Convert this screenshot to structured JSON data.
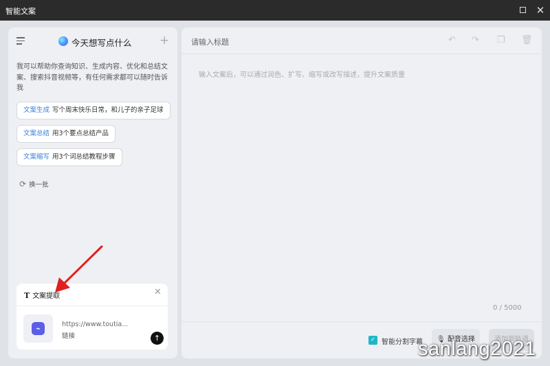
{
  "window": {
    "title": "智能文案",
    "max_icon": "maximize-icon",
    "close_glyph": "✕"
  },
  "assistant": {
    "heading": "今天想写点什么",
    "plus_glyph": "+",
    "intro": "我可以帮助你查询知识、生成内容、优化和总结文案、搜索抖音视频等，有任何需求都可以随时告诉我",
    "suggestions": [
      {
        "tag": "文案生成",
        "text": "写个周末快乐日常，和儿子的亲子足球"
      },
      {
        "tag": "文案总结",
        "text": "用3个要点总结产品"
      },
      {
        "tag": "文案缩写",
        "text": "用3个词总结教程步骤"
      }
    ],
    "refresh_label": "换一批",
    "refresh_glyph": "⟳"
  },
  "extract_card": {
    "title_glyph": "T",
    "title": "文案提取",
    "close_glyph": "✕",
    "url": "https://www.toutia...",
    "url_type": "链接",
    "link_glyph": "⌁",
    "send_glyph": "↑"
  },
  "editor": {
    "title_placeholder": "请输入标题",
    "body_placeholder": "输入文案后，可以通过润色、扩写、缩写或改写描述，提升文案质量",
    "char_count": "0 / 5000",
    "undo_glyph": "↶",
    "redo_glyph": "↷",
    "copy_glyph": "❐",
    "delete_glyph": "🗑",
    "subtitle_checkbox_checked": true,
    "check_glyph": "✓",
    "subtitle_label": "智能分割字幕",
    "voice_button": "配音选择",
    "voice_glyph": "🎙",
    "add_button": "添加到轨道"
  },
  "watermark": "sanlang2021",
  "colors": {
    "accent": "#1fb6c8",
    "tag_blue": "#3b7fd6",
    "annotation_arrow": "#e02020",
    "link_icon_bg": "#5b5ee6"
  }
}
